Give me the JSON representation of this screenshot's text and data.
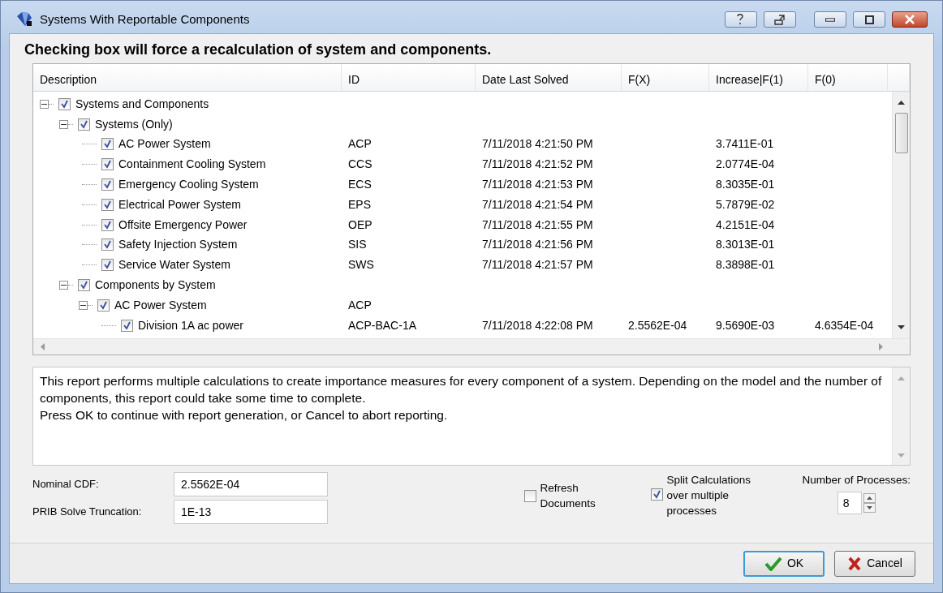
{
  "window": {
    "title": "Systems With Reportable Components"
  },
  "heading": "Checking box will force a recalculation of system and components.",
  "table": {
    "columns": [
      "Description",
      "ID",
      "Date Last Solved",
      "F(X)",
      "Increase|F(1)",
      "F(0)"
    ],
    "rows": [
      {
        "description": "Systems and Components",
        "checked": true,
        "expanded": true,
        "children": [
          {
            "description": "Systems (Only)",
            "checked": true,
            "expanded": true,
            "children": [
              {
                "description": "AC Power System",
                "id": "ACP",
                "date": "7/11/2018 4:21:50 PM",
                "increase": "3.7411E-01",
                "checked": true
              },
              {
                "description": "Containment Cooling System",
                "id": "CCS",
                "date": "7/11/2018 4:21:52 PM",
                "increase": "2.0774E-04",
                "checked": true
              },
              {
                "description": "Emergency Cooling System",
                "id": "ECS",
                "date": "7/11/2018 4:21:53 PM",
                "increase": "8.3035E-01",
                "checked": true
              },
              {
                "description": "Electrical Power System",
                "id": "EPS",
                "date": "7/11/2018 4:21:54 PM",
                "increase": "5.7879E-02",
                "checked": true
              },
              {
                "description": "Offsite Emergency Power",
                "id": "OEP",
                "date": "7/11/2018 4:21:55 PM",
                "increase": "4.2151E-04",
                "checked": true
              },
              {
                "description": "Safety Injection System",
                "id": "SIS",
                "date": "7/11/2018 4:21:56 PM",
                "increase": "8.3013E-01",
                "checked": true
              },
              {
                "description": "Service Water System",
                "id": "SWS",
                "date": "7/11/2018 4:21:57 PM",
                "increase": "8.3898E-01",
                "checked": true
              }
            ]
          },
          {
            "description": "Components by System",
            "checked": true,
            "expanded": true,
            "children": [
              {
                "description": "AC Power System",
                "id": "ACP",
                "checked": true,
                "expanded": true,
                "children": [
                  {
                    "description": "Division 1A ac power",
                    "id": "ACP-BAC-1A",
                    "date": "7/11/2018 4:22:08 PM",
                    "fx": "2.5562E-04",
                    "increase": "9.5690E-03",
                    "f0": "4.6354E-04",
                    "checked": true
                  }
                ]
              }
            ]
          }
        ]
      }
    ]
  },
  "message": [
    "This report performs multiple calculations to create importance measures for every component of a system.  Depending on the model and the number of components, this report could take some time to complete.",
    "Press OK to continue with report generation, or Cancel to abort reporting."
  ],
  "fields": [
    {
      "label": "Nominal CDF:",
      "value": "2.5562E-04"
    },
    {
      "label": "PRIB Solve Truncation:",
      "value": "1E-13"
    }
  ],
  "options": [
    {
      "label": "Refresh Documents",
      "checked": false
    },
    {
      "label": "Split Calculations over multiple processes",
      "checked": true
    }
  ],
  "processes": {
    "label": "Number of Processes:",
    "value": "8"
  },
  "buttons": [
    {
      "label": "OK",
      "kind": "ok"
    },
    {
      "label": "Cancel",
      "kind": "cancel"
    }
  ]
}
